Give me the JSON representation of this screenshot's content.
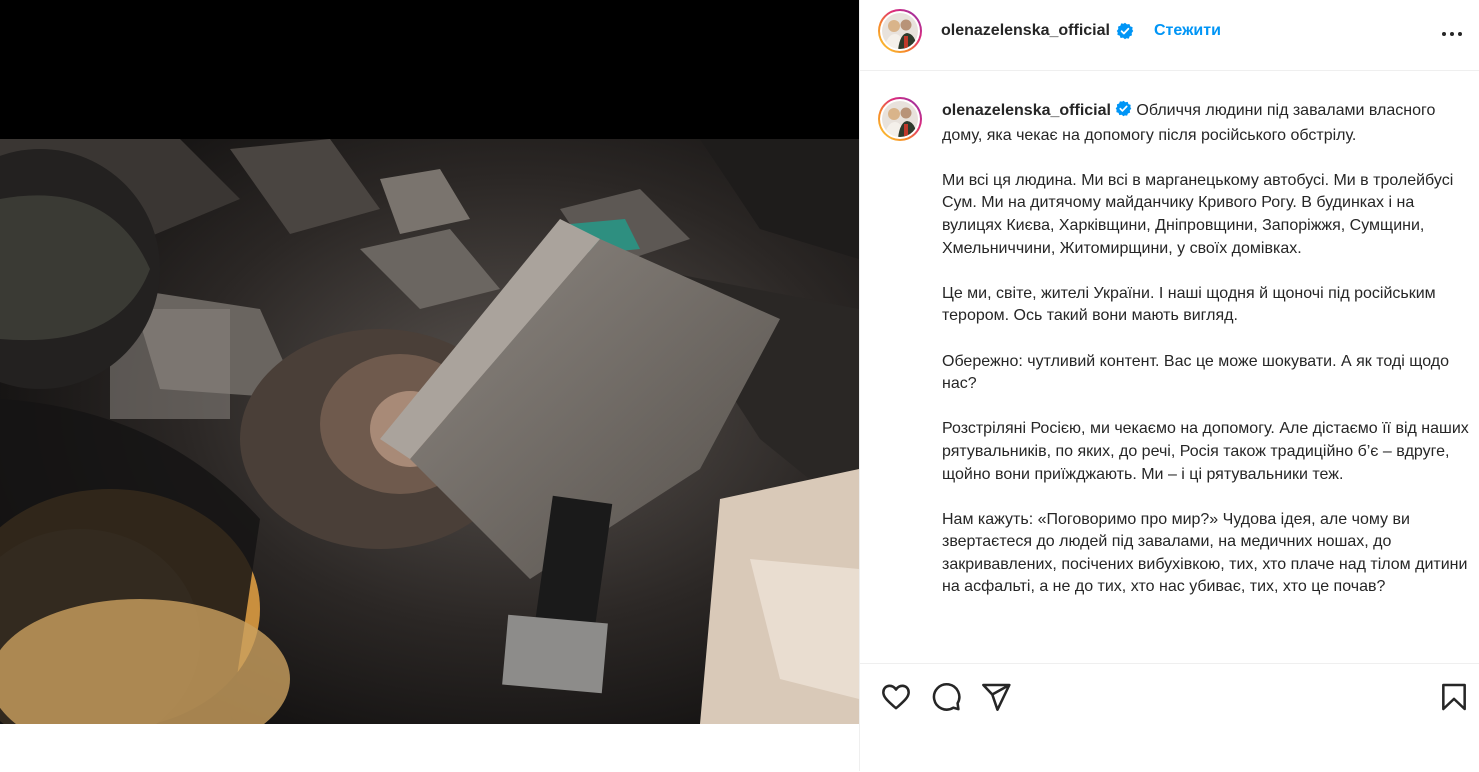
{
  "post": {
    "username": "olenazelenska_official",
    "follow_label": "Стежити",
    "caption_first": "Обличчя людини під завалами власного дому, яка чекає на допомогу після російського обстрілу.",
    "paragraphs": [
      "Ми всі ця людина. Ми всі в марганецькому автобусі. Ми в тролейбусі Сум. Ми на дитячому майданчику Кривого Рогу. В будинках і на вулицях Києва, Харківщини, Дніпровщини, Запоріжжя, Сумщини, Хмельниччини, Житомирщини, у своїх домівках.",
      "Це ми, світе, жителі України. І наші щодня й щоночі під російським терором. Ось такий вони мають вигляд.",
      "Обережно: чутливий контент. Вас це може шокувати. А як тоді щодо нас?",
      "Розстріляні Росією, ми чекаємо на допомогу. Але дістаємо її від наших рятувальників, по яких, до речі, Росія також традиційно б’є – вдруге, щойно вони приїжджають. Ми – і ці рятувальники теж.",
      "Нам кажуть: «Поговоримо про мир?» Чудова ідея, але чому ви звертаєтеся до людей під завалами, на медичних ношах, до закривавлених, посічених вибухівкою, тих, хто плаче над тілом дитини на асфальті, а не до тих, хто нас убиває, тих, хто це почав?"
    ]
  },
  "icons": {
    "verified": "verified-badge-icon",
    "more": "more-options-icon",
    "like": "heart-icon",
    "comment": "comment-icon",
    "share": "share-icon",
    "save": "bookmark-icon"
  },
  "colors": {
    "link": "#0095f6",
    "text": "#262626",
    "verified": "#0095f6"
  }
}
